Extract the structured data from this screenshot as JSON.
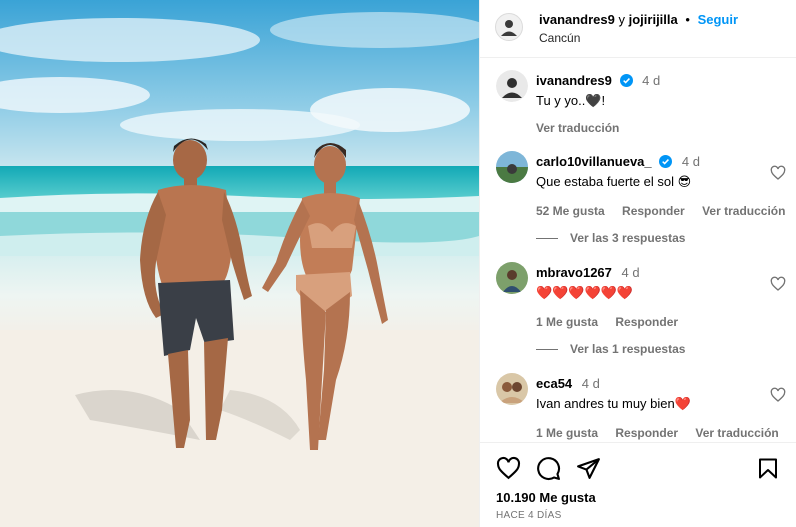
{
  "post": {
    "header": {
      "author": "ivanandres9",
      "connector": "y",
      "coauthor": "jojirijilla",
      "dot": "•",
      "follow_label": "Seguir",
      "location": "Cancún"
    },
    "caption": {
      "username": "ivanandres9",
      "verified": true,
      "time": "4 d",
      "text": "Tu y yo..🖤!",
      "translate_label": "Ver traducción"
    },
    "comments": [
      {
        "username": "carlo10villanueva_",
        "verified": true,
        "time": "4 d",
        "text": "Que estaba fuerte el sol 😎",
        "likes": "52 Me gusta",
        "reply_label": "Responder",
        "translate_label": "Ver traducción",
        "view_replies": "Ver las 3 respuestas"
      },
      {
        "username": "mbravo1267",
        "verified": false,
        "time": "4 d",
        "text": "❤️❤️❤️❤️❤️❤️",
        "likes": "1 Me gusta",
        "reply_label": "Responder",
        "view_replies": "Ver las 1 respuestas"
      },
      {
        "username": "eca54",
        "verified": false,
        "time": "4 d",
        "text": "Ivan andres tu muy bien❤️",
        "likes": "1 Me gusta",
        "reply_label": "Responder",
        "translate_label": "Ver traducción"
      }
    ],
    "likes_count": "10.190 Me gusta",
    "posted_ago": "HACE 4 DÍAS"
  },
  "colors": {
    "accent": "#0095f6",
    "verified": "#0095f6",
    "secondary_text": "#737373",
    "heart": "#ff3040"
  },
  "icons": {
    "like": "heart-outline-icon",
    "comment": "speech-bubble-icon",
    "share": "paper-plane-icon",
    "save": "bookmark-icon",
    "verified": "verified-badge-icon"
  }
}
